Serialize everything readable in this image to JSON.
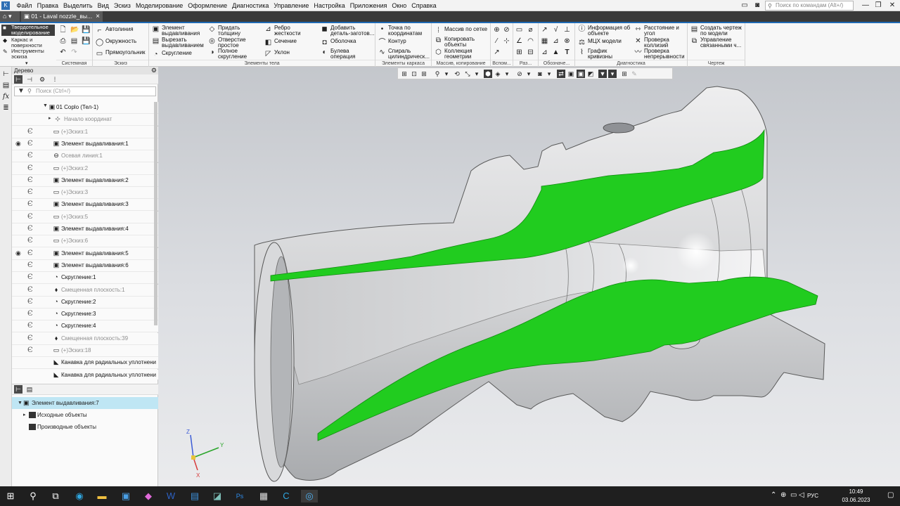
{
  "menubar": {
    "items": [
      "Файл",
      "Правка",
      "Выделить",
      "Вид",
      "Эскиз",
      "Моделирование",
      "Оформление",
      "Диагностика",
      "Управление",
      "Настройка",
      "Приложения",
      "Окно",
      "Справка"
    ],
    "search_placeholder": "Поиск по командам (Alt+/)"
  },
  "tabs": {
    "home_icon": "home-icon",
    "document_tab": "01 - Laval nozzle_вы..."
  },
  "ribbon": {
    "modes": [
      "Твердотельное\nмоделирование",
      "Каркас и\nповерхности",
      "Инструменты\nэскиза"
    ],
    "groups": {
      "system": "Системная",
      "sketch": "Эскиз",
      "body": "Элементы тела",
      "frame": "Элементы каркаса",
      "arrays": "Массив, копирование",
      "aux": "Вспом...",
      "sizes": "Раз...",
      "designations": "Обозначе...",
      "diagnostics": "Диагностика",
      "drawing": "Чертеж"
    },
    "sketch_buttons": [
      "Автолиния",
      "Окружность",
      "Прямоугольник"
    ],
    "body_buttons": [
      "Элемент\nвыдавливания",
      "Вырезать\nвыдавливанием",
      "Скругление",
      "Придать\nтолщину",
      "Отверстие\nпростое",
      "Полное\nскругление",
      "Ребро\nжесткости",
      "Сечение",
      "Уклон",
      "Добавить\nдеталь-заготов...",
      "Оболочка",
      "Булева\nоперация"
    ],
    "frame_buttons": [
      "Точка по\nкоординатам",
      "Контур",
      "Спираль\nцилиндрическ..."
    ],
    "array_buttons": [
      "Массив по сетке",
      "Копировать\nобъекты",
      "Коллекция\nгеометрии"
    ],
    "diag_buttons": [
      "Информация об\nобъекте",
      "МЦХ модели",
      "График\nкривизны",
      "Расстояние и\nугол",
      "Проверка\nколлизий",
      "Проверка\nнепрерывности"
    ],
    "drawing_buttons": [
      "Создать чертеж\nпо модели",
      "Управление\nсвязанными ч..."
    ]
  },
  "tree": {
    "title": "Дерево",
    "search_placeholder": "Поиск (Ctrl+/)",
    "root": "01 Coplo (Тел-1)",
    "rows": [
      {
        "label": "Начало координат",
        "muted": true,
        "eye": false
      },
      {
        "label": "(+)Эскиз:1",
        "muted": true,
        "eye": false
      },
      {
        "label": "Элемент выдавливания:1",
        "muted": false,
        "eye": true
      },
      {
        "label": "Осевая линия:1",
        "muted": true,
        "eye": false
      },
      {
        "label": "(+)Эскиз:2",
        "muted": true,
        "eye": false
      },
      {
        "label": "Элемент выдавливания:2",
        "muted": false,
        "eye": false
      },
      {
        "label": "(+)Эскиз:3",
        "muted": true,
        "eye": false
      },
      {
        "label": "Элемент выдавливания:3",
        "muted": false,
        "eye": false
      },
      {
        "label": "(+)Эскиз:5",
        "muted": true,
        "eye": false
      },
      {
        "label": "Элемент выдавливания:4",
        "muted": false,
        "eye": false
      },
      {
        "label": "(+)Эскиз:6",
        "muted": true,
        "eye": false
      },
      {
        "label": "Элемент выдавливания:5",
        "muted": false,
        "eye": true
      },
      {
        "label": "Элемент выдавливания:6",
        "muted": false,
        "eye": false
      },
      {
        "label": "Скругление:1",
        "muted": false,
        "eye": false
      },
      {
        "label": "Смещенная плоскость:1",
        "muted": true,
        "eye": false
      },
      {
        "label": "Скругление:2",
        "muted": false,
        "eye": false
      },
      {
        "label": "Скругление:3",
        "muted": false,
        "eye": false
      },
      {
        "label": "Скругление:4",
        "muted": false,
        "eye": false
      },
      {
        "label": "Смещенная плоскость:39",
        "muted": true,
        "eye": false
      },
      {
        "label": "(+)Эскиз:18",
        "muted": true,
        "eye": false
      },
      {
        "label": "Канавка для радиальных уплотнени",
        "muted": false,
        "eye": false
      },
      {
        "label": "Канавка для радиальных уплотнени",
        "muted": false,
        "eye": false
      }
    ]
  },
  "properties": {
    "selected": "Элемент выдавливания:7",
    "children": [
      "Исходные объекты",
      "Производные объекты"
    ]
  },
  "axes": {
    "z": "Z",
    "y": "Y",
    "x": "X"
  },
  "colors": {
    "section_fill": "#21cc1f",
    "body": "#d2d3d5",
    "accent": "#1f6ab4"
  },
  "taskbar": {
    "language": "РУС",
    "time": "10:49",
    "date": "03.06.2023"
  }
}
